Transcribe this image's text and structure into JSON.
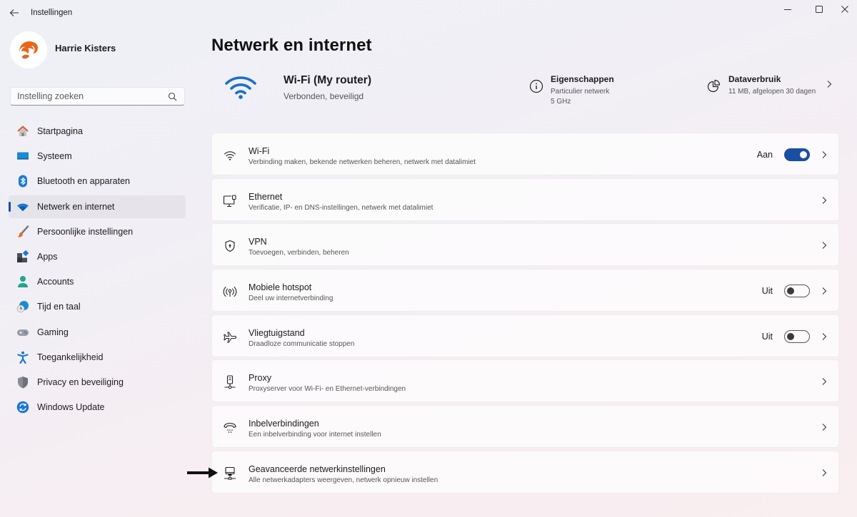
{
  "window": {
    "title": "Instellingen",
    "controls": [
      "minimize",
      "maximize",
      "close"
    ]
  },
  "profile": {
    "name": "Harrie Kisters"
  },
  "search": {
    "placeholder": "Instelling zoeken",
    "value": ""
  },
  "sidebar": {
    "items": [
      {
        "label": "Startpagina",
        "icon": "home-icon",
        "active": false
      },
      {
        "label": "Systeem",
        "icon": "system-icon",
        "active": false
      },
      {
        "label": "Bluetooth en apparaten",
        "icon": "bluetooth-icon",
        "active": false
      },
      {
        "label": "Netwerk en internet",
        "icon": "wifi-icon",
        "active": true
      },
      {
        "label": "Persoonlijke instellingen",
        "icon": "brush-icon",
        "active": false
      },
      {
        "label": "Apps",
        "icon": "apps-icon",
        "active": false
      },
      {
        "label": "Accounts",
        "icon": "account-icon",
        "active": false
      },
      {
        "label": "Tijd en taal",
        "icon": "time-language-icon",
        "active": false
      },
      {
        "label": "Gaming",
        "icon": "gamepad-icon",
        "active": false
      },
      {
        "label": "Toegankelijkheid",
        "icon": "accessibility-icon",
        "active": false
      },
      {
        "label": "Privacy en beveiliging",
        "icon": "shield-icon",
        "active": false
      },
      {
        "label": "Windows Update",
        "icon": "update-icon",
        "active": false
      }
    ]
  },
  "main": {
    "title": "Netwerk en internet",
    "connection": {
      "name": "Wi-Fi (My router)",
      "status": "Verbonden, beveiligd"
    },
    "properties": {
      "title": "Eigenschappen",
      "line1": "Particulier netwerk",
      "line2": "5 GHz"
    },
    "data_usage": {
      "title": "Dataverbruik",
      "line1": "11 MB, afgelopen 30 dagen"
    },
    "cards": [
      {
        "title": "Wi-Fi",
        "subtitle": "Verbinding maken, bekende netwerken beheren, netwerk met datalimiet",
        "icon": "wifi-icon",
        "toggle": "on",
        "toggle_label": "Aan"
      },
      {
        "title": "Ethernet",
        "subtitle": "Verificatie, IP- en DNS-instellingen, netwerk met datalimiet",
        "icon": "ethernet-icon"
      },
      {
        "title": "VPN",
        "subtitle": "Toevoegen, verbinden, beheren",
        "icon": "vpn-shield-icon"
      },
      {
        "title": "Mobiele hotspot",
        "subtitle": "Deel uw internetverbinding",
        "icon": "hotspot-icon",
        "toggle": "off",
        "toggle_label": "Uit"
      },
      {
        "title": "Vliegtuigstand",
        "subtitle": "Draadloze communicatie stoppen",
        "icon": "airplane-icon",
        "toggle": "off",
        "toggle_label": "Uit"
      },
      {
        "title": "Proxy",
        "subtitle": "Proxyserver voor Wi-Fi- en Ethernet-verbindingen",
        "icon": "proxy-icon"
      },
      {
        "title": "Inbelverbindingen",
        "subtitle": "Een inbelverbinding voor internet instellen",
        "icon": "dialup-icon"
      },
      {
        "title": "Geavanceerde netwerkinstellingen",
        "subtitle": "Alle netwerkadapters weergeven, netwerk opnieuw instellen",
        "icon": "network-pc-icon"
      }
    ]
  },
  "colors": {
    "accent": "#1a4ea1",
    "wifi_hero": "#1a6fc9"
  }
}
